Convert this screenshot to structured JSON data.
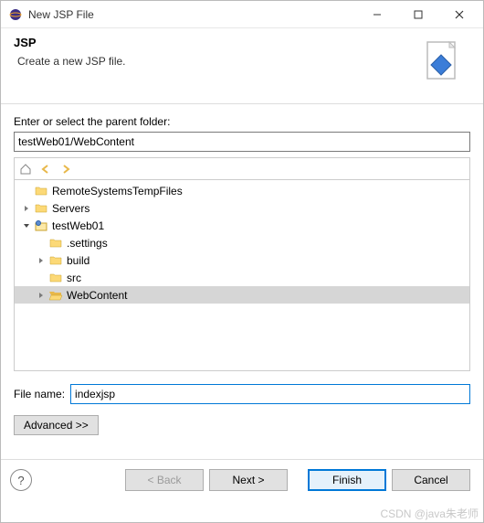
{
  "window": {
    "title": "New JSP File"
  },
  "header": {
    "title": "JSP",
    "description": "Create a new JSP file."
  },
  "folderSection": {
    "label": "Enter or select the parent folder:",
    "value": "testWeb01/WebContent"
  },
  "tree": {
    "items": [
      {
        "depth": 0,
        "twisty": "",
        "icon": "folder",
        "label": "RemoteSystemsTempFiles",
        "selected": false
      },
      {
        "depth": 0,
        "twisty": ">",
        "icon": "folder",
        "label": "Servers",
        "selected": false
      },
      {
        "depth": 0,
        "twisty": "v",
        "icon": "project",
        "label": "testWeb01",
        "selected": false
      },
      {
        "depth": 1,
        "twisty": "",
        "icon": "folder",
        "label": ".settings",
        "selected": false
      },
      {
        "depth": 1,
        "twisty": ">",
        "icon": "folder",
        "label": "build",
        "selected": false
      },
      {
        "depth": 1,
        "twisty": "",
        "icon": "folder",
        "label": "src",
        "selected": false
      },
      {
        "depth": 1,
        "twisty": ">",
        "icon": "folder-open",
        "label": "WebContent",
        "selected": true
      }
    ]
  },
  "filename": {
    "label": "File name:",
    "value": "indexjsp"
  },
  "advanced": {
    "label": "Advanced >>"
  },
  "buttons": {
    "back": "< Back",
    "next": "Next >",
    "finish": "Finish",
    "cancel": "Cancel"
  },
  "watermark": "CSDN @java朱老师"
}
